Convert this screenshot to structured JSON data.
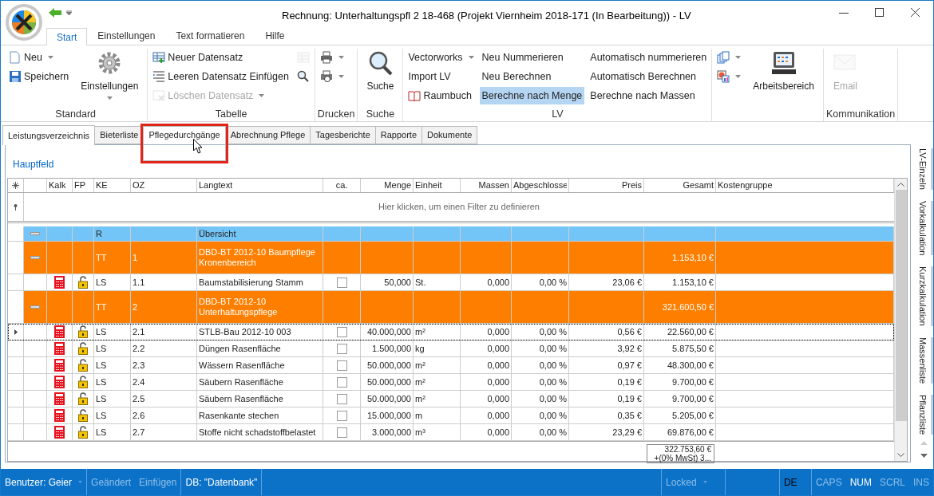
{
  "window": {
    "title": "Rechnung:  Unterhaltungspfl 2 18-468 (Projekt Viernheim 2018-171 (In Bearbeitung)) - LV"
  },
  "ribbon_tabs": [
    {
      "label": "Start",
      "selected": true
    },
    {
      "label": "Einstellungen",
      "selected": false
    },
    {
      "label": "Text formatieren",
      "selected": false
    },
    {
      "label": "Hilfe",
      "selected": false
    }
  ],
  "ribbon_groups": [
    {
      "label": "Standard",
      "columns": [
        [
          {
            "kind": "small",
            "label": "Neu",
            "dropdown": true,
            "disabled": false,
            "selected": false
          },
          {
            "kind": "small",
            "label": "Speichern",
            "dropdown": false,
            "disabled": false,
            "selected": false
          }
        ],
        [
          {
            "kind": "large",
            "label": "Einstellungen",
            "dropdown": true,
            "disabled": false,
            "selected": false
          }
        ]
      ]
    },
    {
      "label": "Tabelle",
      "columns": [
        [
          {
            "kind": "small",
            "label": "Neuer Datensatz",
            "dropdown": false,
            "disabled": false,
            "selected": false
          },
          {
            "kind": "small",
            "label": "Leeren Datensatz Einfügen",
            "dropdown": false,
            "disabled": false,
            "selected": false
          },
          {
            "kind": "small",
            "label": "Löschen Datensatz",
            "dropdown": true,
            "disabled": true,
            "selected": false
          }
        ],
        [
          {
            "kind": "small",
            "dropdown": false,
            "disabled": true,
            "selected": false
          },
          {
            "kind": "small",
            "dropdown": false,
            "disabled": false,
            "selected": false
          }
        ]
      ]
    },
    {
      "label": "Drucken",
      "columns": [
        [
          {
            "kind": "small",
            "dropdown": true,
            "disabled": false,
            "selected": false
          },
          {
            "kind": "small",
            "dropdown": true,
            "disabled": false,
            "selected": false
          }
        ]
      ]
    },
    {
      "label": "Suche",
      "columns": [
        [
          {
            "kind": "large",
            "label": "Suche",
            "dropdown": false,
            "disabled": false,
            "selected": false
          }
        ]
      ]
    },
    {
      "label": "LV",
      "columns": [
        [
          {
            "kind": "small",
            "label": "Vectorworks",
            "dropdown": true,
            "disabled": false,
            "selected": false
          },
          {
            "kind": "small",
            "label": "Import LV",
            "dropdown": false,
            "disabled": false,
            "selected": false
          },
          {
            "kind": "small",
            "label": "Raumbuch",
            "dropdown": false,
            "disabled": false,
            "selected": false
          }
        ],
        [
          {
            "kind": "small",
            "label": "Neu Nummerieren",
            "dropdown": false,
            "disabled": false,
            "selected": false
          },
          {
            "kind": "small",
            "label": "Neu Berechnen",
            "dropdown": false,
            "disabled": false,
            "selected": false
          },
          {
            "kind": "small",
            "label": "Berechne nach Menge",
            "dropdown": false,
            "disabled": false,
            "selected": true
          }
        ],
        [
          {
            "kind": "small",
            "label": "Automatisch nummerieren",
            "dropdown": false,
            "disabled": false,
            "selected": false
          },
          {
            "kind": "small",
            "label": "Automatisch Berechnen",
            "dropdown": false,
            "disabled": false,
            "selected": false
          },
          {
            "kind": "small",
            "label": "Berechne nach Massen",
            "dropdown": false,
            "disabled": false,
            "selected": false
          }
        ]
      ]
    },
    {
      "columns": [
        [
          {
            "kind": "small",
            "dropdown": true,
            "disabled": false,
            "selected": false
          },
          {
            "kind": "small",
            "dropdown": true,
            "disabled": false,
            "selected": false
          }
        ],
        [
          {
            "kind": "large",
            "label": "Arbeitsbereich",
            "dropdown": false,
            "disabled": false,
            "selected": false
          }
        ]
      ]
    },
    {
      "label": "Kommunikation",
      "columns": [
        [
          {
            "kind": "large",
            "label": "Email",
            "dropdown": false,
            "disabled": true,
            "selected": false
          }
        ]
      ]
    }
  ],
  "doc_tabs": [
    {
      "label": "Leistungsverzeichnis",
      "selected": true,
      "highlighted": false
    },
    {
      "label": "Bieterliste",
      "selected": false,
      "highlighted": false
    },
    {
      "label": "Pflegedurchgänge",
      "selected": false,
      "highlighted": true
    },
    {
      "label": "Abrechnung Pflege",
      "selected": false,
      "highlighted": false
    },
    {
      "label": "Tagesberichte",
      "selected": false,
      "highlighted": false
    },
    {
      "label": "Rapporte",
      "selected": false,
      "highlighted": false
    },
    {
      "label": "Dokumente",
      "selected": false,
      "highlighted": false
    }
  ],
  "breadcrumb": "Hauptfeld",
  "table": {
    "columns": [
      "Kalk",
      "FP",
      "KE",
      "OZ",
      "Langtext",
      "ca.",
      "Menge",
      "Einheit",
      "Massen",
      "Abgeschlosse",
      "Preis",
      "Gesamt",
      "Kostengruppe"
    ],
    "filter_hint": "Hier klicken, um einen Filter zu definieren",
    "rows": [
      {
        "kind": "summary",
        "ke": "R",
        "text": "Übersicht"
      },
      {
        "kind": "group",
        "ke": "TT",
        "oz": "1",
        "text": "DBD-BT 2012-10 Baumpflege Kronenbereich",
        "gesamt": "1.153,10 €"
      },
      {
        "kind": "item",
        "current": false,
        "ke": "LS",
        "oz": "1.1",
        "text": "Baumstabilisierung Stamm",
        "ca": false,
        "menge": "50,000",
        "einheit": "St.",
        "massen": "0,000",
        "abgeschlossen": "0,00 %",
        "preis": "23,06 €",
        "gesamt": "1.153,10 €"
      },
      {
        "kind": "group",
        "ke": "TT",
        "oz": "2",
        "text": "DBD-BT 2012-10 Unterhaltungspflege",
        "gesamt": "321.600,50 €"
      },
      {
        "kind": "item",
        "current": true,
        "ke": "LS",
        "oz": "2.1",
        "text": "STLB-Bau 2012-10 003",
        "ca": false,
        "menge": "40.000,000",
        "einheit": "m²",
        "massen": "0,000",
        "abgeschlossen": "0,00 %",
        "preis": "0,56 €",
        "gesamt": "22.560,00 €"
      },
      {
        "kind": "item",
        "current": false,
        "ke": "LS",
        "oz": "2.2",
        "text": "Düngen Rasenfläche",
        "ca": false,
        "menge": "1.500,000",
        "einheit": "kg",
        "massen": "0,000",
        "abgeschlossen": "0,00 %",
        "preis": "3,92 €",
        "gesamt": "5.875,50 €"
      },
      {
        "kind": "item",
        "current": false,
        "ke": "LS",
        "oz": "2.3",
        "text": "Wässern Rasenfläche",
        "ca": false,
        "menge": "50.000,000",
        "einheit": "m²",
        "massen": "0,000",
        "abgeschlossen": "0,00 %",
        "preis": "0,97 €",
        "gesamt": "48.300,00 €"
      },
      {
        "kind": "item",
        "current": false,
        "ke": "LS",
        "oz": "2.4",
        "text": "Säubern Rasenfläche",
        "ca": false,
        "menge": "50.000,000",
        "einheit": "m²",
        "massen": "0,000",
        "abgeschlossen": "0,00 %",
        "preis": "0,19 €",
        "gesamt": "9.700,00 €"
      },
      {
        "kind": "item",
        "current": false,
        "ke": "LS",
        "oz": "2.5",
        "text": "Säubern Rasenfläche",
        "ca": false,
        "menge": "50.000,000",
        "einheit": "m²",
        "massen": "0,000",
        "abgeschlossen": "0,00 %",
        "preis": "0,19 €",
        "gesamt": "9.700,00 €"
      },
      {
        "kind": "item",
        "current": false,
        "ke": "LS",
        "oz": "2.6",
        "text": "Rasenkante stechen",
        "ca": false,
        "menge": "15.000,000",
        "einheit": "m",
        "massen": "0,000",
        "abgeschlossen": "0,00 %",
        "preis": "0,35 €",
        "gesamt": "5.205,00 €"
      },
      {
        "kind": "item",
        "current": false,
        "ke": "LS",
        "oz": "2.7",
        "text": "Stoffe nicht schadstoffbelastet",
        "ca": false,
        "menge": "3.000,000",
        "einheit": "m³",
        "massen": "0,000",
        "abgeschlossen": "0,00 %",
        "preis": "23,29 €",
        "gesamt": "69.876,00 €"
      }
    ],
    "total": [
      "322.753,60 €",
      "+(0% MwSt) 3..."
    ]
  },
  "side_tabs": [
    "LV-Einzeln",
    "Vorkalkulation",
    "Kurzkalkulation",
    "Massenliste",
    "Pflanzliste"
  ],
  "status_bar": [
    {
      "label": "Benutzer: Geier",
      "enabled": true,
      "dropdown": true
    },
    {
      "label": "Geändert",
      "enabled": false
    },
    {
      "label": "Einfügen",
      "enabled": false
    },
    {
      "label": "DB: \"Datenbank\"",
      "enabled": true
    },
    {
      "kind": "spacer"
    },
    {
      "label": "Locked",
      "enabled": false,
      "dropdown": true
    },
    {
      "kind": "blank"
    },
    {
      "label": "DE",
      "enabled": true,
      "kind": "lang"
    },
    {
      "label": "CAPS",
      "enabled": false
    },
    {
      "label": "NUM",
      "enabled": true
    },
    {
      "label": "SCRL",
      "enabled": false
    },
    {
      "label": "INS",
      "enabled": false
    }
  ]
}
